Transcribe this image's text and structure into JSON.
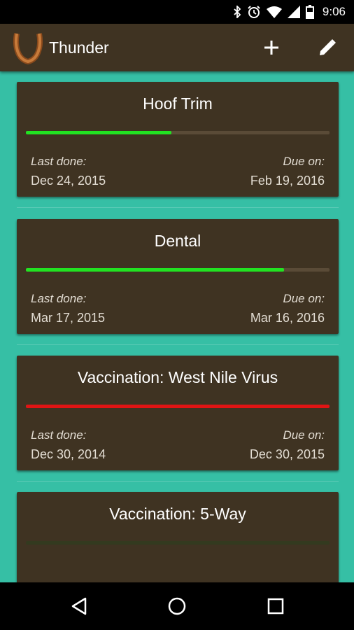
{
  "status_bar": {
    "time": "9:06",
    "icons": [
      "bluetooth-icon",
      "alarm-icon",
      "wifi-icon",
      "signal-icon",
      "battery-icon"
    ]
  },
  "app_bar": {
    "logo": "horseshoe-logo",
    "title": "Thunder",
    "actions": [
      "add-icon",
      "edit-icon"
    ]
  },
  "colors": {
    "app_bar": "#3f3322",
    "background": "#36bfa5",
    "card": "#3f3322",
    "progress_ok": "#22e322",
    "progress_overdue": "#e01414"
  },
  "cards": [
    {
      "title": "Hoof Trim",
      "progress": 0.48,
      "status": "ok",
      "last_done_label": "Last done:",
      "last_done": "Dec 24, 2015",
      "due_label": "Due on:",
      "due": "Feb 19, 2016"
    },
    {
      "title": "Dental",
      "progress": 0.85,
      "status": "ok",
      "last_done_label": "Last done:",
      "last_done": "Mar 17, 2015",
      "due_label": "Due on:",
      "due": "Mar 16, 2016"
    },
    {
      "title": "Vaccination: West Nile Virus",
      "progress": 1.0,
      "status": "overdue",
      "last_done_label": "Last done:",
      "last_done": "Dec 30, 2014",
      "due_label": "Due on:",
      "due": "Dec 30, 2015"
    },
    {
      "title": "Vaccination: 5-Way",
      "progress": 0.0,
      "status": "ok"
    }
  ],
  "nav_bar": {
    "buttons": [
      "back-icon",
      "home-icon",
      "recents-icon"
    ]
  }
}
